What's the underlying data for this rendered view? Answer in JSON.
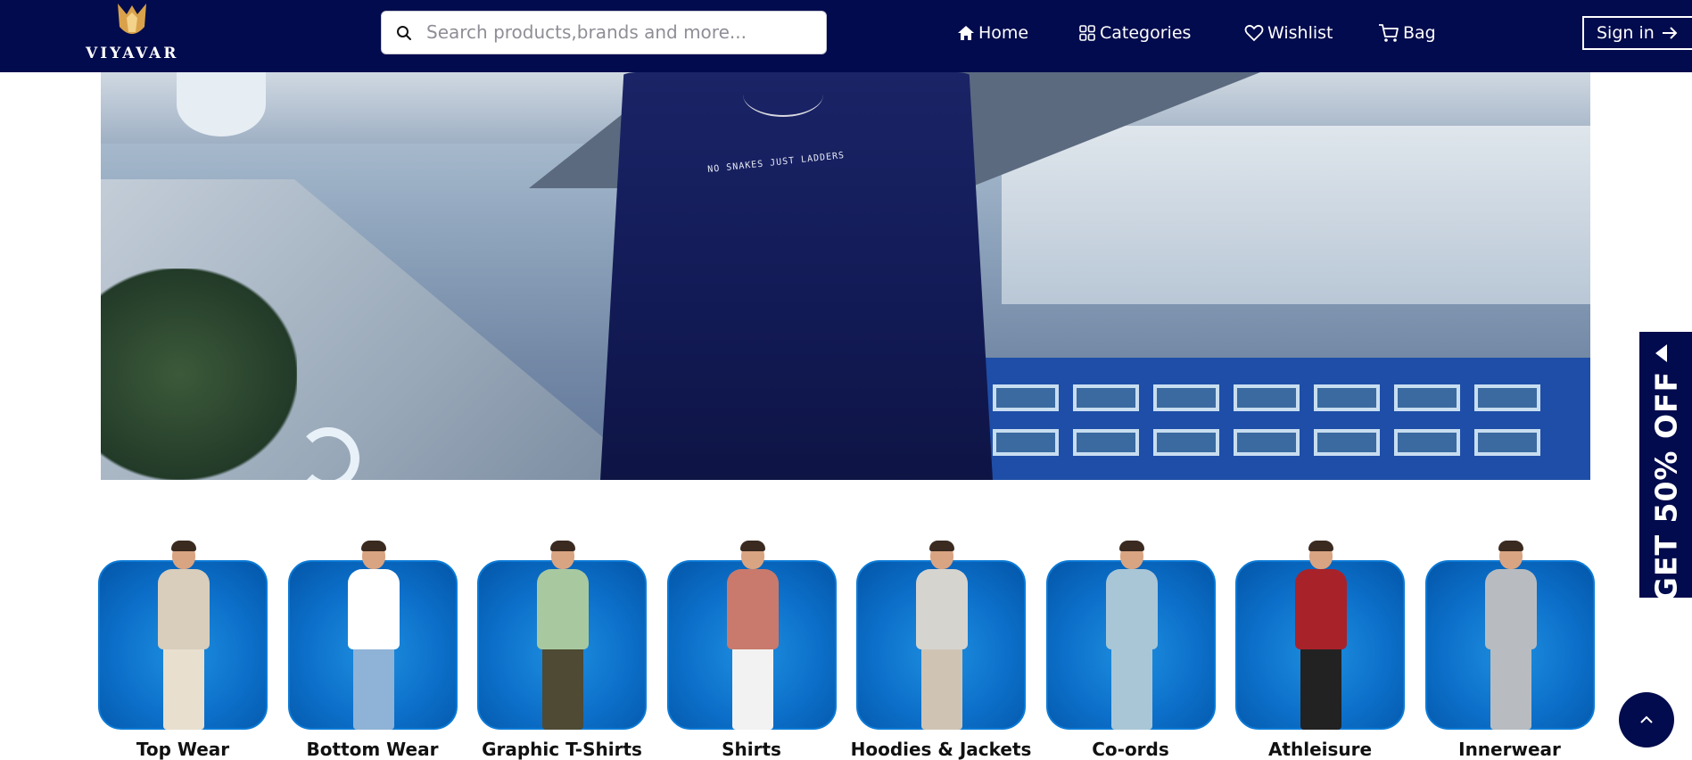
{
  "brand": {
    "name": "VIYAVAR"
  },
  "search": {
    "placeholder": "Search products,brands and more..."
  },
  "nav": {
    "home": "Home",
    "categories": "Categories",
    "wishlist": "Wishlist",
    "bag": "Bag",
    "signin": "Sign in"
  },
  "hero": {
    "shirt_print": "NO SNAKES JUST LADDERS"
  },
  "offer": {
    "label": "GET 50% OFF"
  },
  "categories": [
    {
      "label": "Top Wear",
      "top": "#d9cdbb",
      "bottom": "#e8dfcf"
    },
    {
      "label": "Bottom Wear",
      "top": "#ffffff",
      "bottom": "#8fb3d6"
    },
    {
      "label": "Graphic T-Shirts",
      "top": "#a8c9a0",
      "bottom": "#4e4a34"
    },
    {
      "label": "Shirts",
      "top": "#c97a6c",
      "bottom": "#f2f2f2"
    },
    {
      "label": "Hoodies & Jackets",
      "top": "#d6d4cf",
      "bottom": "#cfc4b4"
    },
    {
      "label": "Co-ords",
      "top": "#a9c6d6",
      "bottom": "#a9c6d6"
    },
    {
      "label": "Athleisure",
      "top": "#a8222a",
      "bottom": "#222222"
    },
    {
      "label": "Innerwear",
      "top": "#b8bcc0",
      "bottom": "#b8bcc0"
    }
  ],
  "colors": {
    "header_bg": "#020b4d",
    "card_blue": "#0c6fc9"
  }
}
